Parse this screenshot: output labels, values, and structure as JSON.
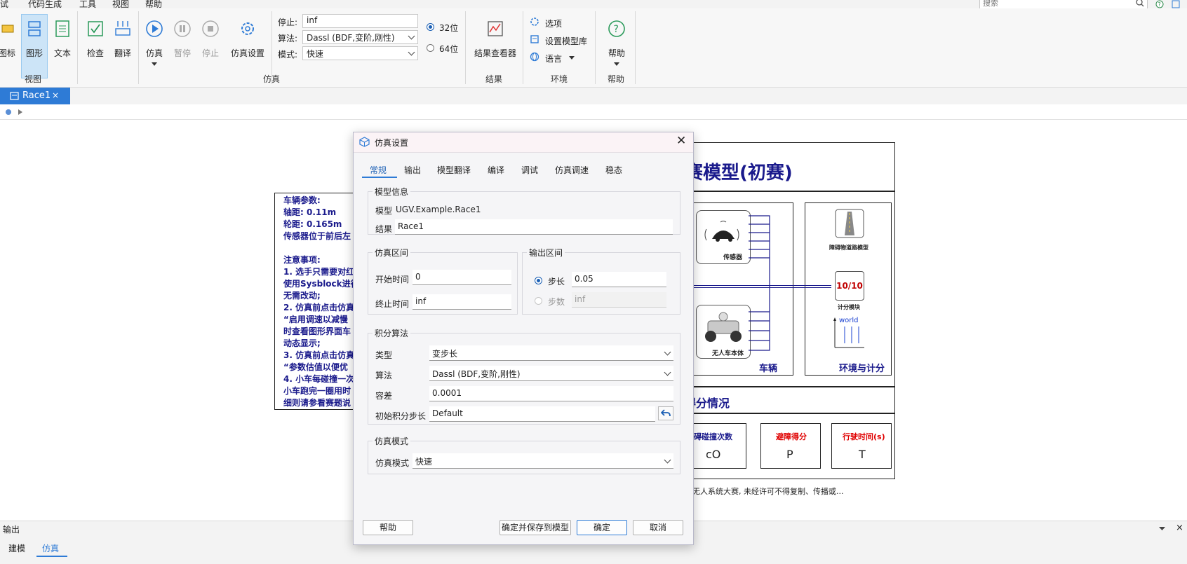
{
  "menubar": [
    "试",
    "代码生成",
    "工具",
    "视图",
    "帮助"
  ],
  "search": {
    "placeholder": "搜索"
  },
  "ribbon": {
    "view_buttons": [
      "图标",
      "图形",
      "文本"
    ],
    "view_group": "视图",
    "check_label": "检查",
    "translate_label": "翻译",
    "sim_label": "仿真",
    "pause_label": "暂停",
    "stop_label": "停止",
    "simsetting_label": "仿真设置",
    "stop_field_label": "停止:",
    "stop_value": "inf",
    "algo_field_label": "算法:",
    "algo_value": "Dassl (BDF,变阶,刚性)",
    "mode_field_label": "模式:",
    "mode_value": "快速",
    "bit32": "32位",
    "bit64": "64位",
    "sim_group": "仿真",
    "result_viewer": "结果查看器",
    "result_group": "结果",
    "options": "选项",
    "model_lib": "设置模型库",
    "language": "语言",
    "env_group": "环境",
    "help": "帮助",
    "help_group": "帮助"
  },
  "doc_tab": {
    "label": "Race1",
    "close": "×"
  },
  "diagram": {
    "title": "赛模型(初赛)",
    "notes": [
      "车辆参数:",
      "轴距: 0.11m",
      "轮距: 0.165m",
      "传感器位于前后左",
      "",
      "注意事项:",
      "1. 选手只需要对红",
      "使用Sysblock进行",
      "无需改动;",
      "2. 仿真前点击仿真",
      "“启用调速以减慢",
      "时查看图形界面车",
      "动态显示;",
      "3. 仿真前点击仿真",
      "“参数估值以便优",
      "4. 小车每碰撞一次",
      "小车跑完一圈用时",
      "细则请参看赛题说"
    ],
    "sensor_label": "传感器",
    "body_label": "无人车本体",
    "vehicle_label": "车辆",
    "obstacle_label": "障碍物道路模型",
    "score_label": "计分模块",
    "score_icon": "10/10",
    "world_label": "world",
    "env_label": "环境与计分",
    "score_section": "得分情况",
    "score_boxes": [
      {
        "title": "障碍碰撞次数",
        "value": "cO"
      },
      {
        "title": "避障得分",
        "value": "P"
      },
      {
        "title": "行驶时间(s)",
        "value": "T"
      }
    ],
    "footer": "无人系统大赛, 未经许可不得复制、传播或..."
  },
  "output_pane": {
    "title": "输出",
    "tabs": [
      "建模",
      "仿真"
    ]
  },
  "dialog": {
    "title": "仿真设置",
    "tabs": [
      "常规",
      "输出",
      "模型翻译",
      "编译",
      "调试",
      "仿真调速",
      "稳态"
    ],
    "model_info": {
      "legend": "模型信息",
      "model_label": "模型",
      "model_value": "UGV.Example.Race1",
      "result_label": "结果",
      "result_value": "Race1"
    },
    "sim_interval": {
      "legend": "仿真区间",
      "start_label": "开始时间",
      "start_value": "0",
      "end_label": "终止时间",
      "end_value": "inf"
    },
    "output_interval": {
      "legend": "输出区间",
      "step_label": "步长",
      "step_value": "0.05",
      "count_label": "步数",
      "count_value": "inf"
    },
    "integration": {
      "legend": "积分算法",
      "type_label": "类型",
      "type_value": "变步长",
      "algo_label": "算法",
      "algo_value": "Dassl (BDF,变阶,刚性)",
      "tol_label": "容差",
      "tol_value": "0.0001",
      "init_label": "初始积分步长",
      "init_value": "Default"
    },
    "sim_mode": {
      "legend": "仿真模式",
      "mode_label": "仿真模式",
      "mode_value": "快速"
    },
    "buttons": {
      "help": "帮助",
      "save_ok": "确定并保存到模型",
      "ok": "确定",
      "cancel": "取消"
    }
  },
  "colors": {
    "accent": "#2e7bd6",
    "navy": "#1a1a8c",
    "red": "#e00000"
  }
}
